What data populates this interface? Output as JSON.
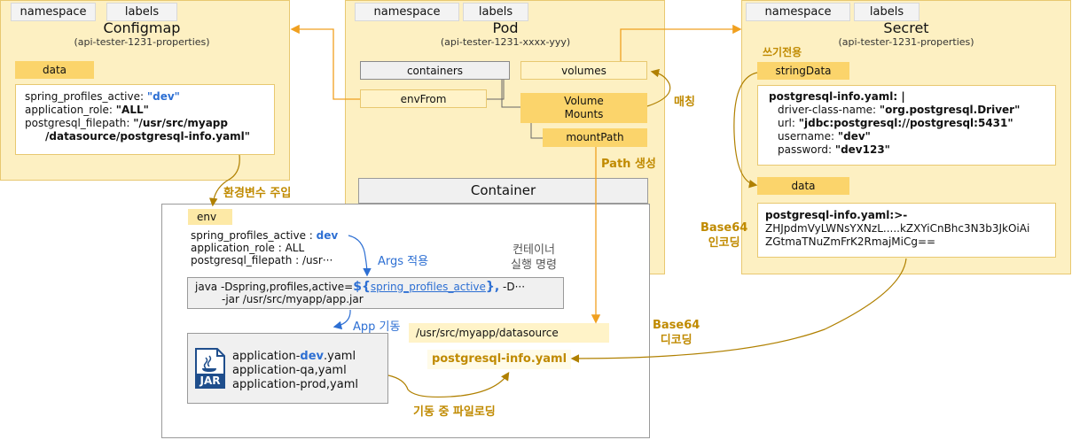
{
  "configmap": {
    "tab_namespace": "namespace",
    "tab_labels": "labels",
    "title": "Configmap",
    "subtitle": "(api-tester-1231-properties)",
    "data_chip": "data",
    "line1_key": "spring_profiles_active: ",
    "line1_val": "\"dev\"",
    "line2_key": "application_role: ",
    "line2_val": "\"ALL\"",
    "line3_key": "postgresql_filepath: ",
    "line3_val": "\"/usr/src/myapp",
    "line4_val": "/datasource/postgresql-info.yaml\""
  },
  "pod": {
    "tab_namespace": "namespace",
    "tab_labels": "labels",
    "title": "Pod",
    "subtitle": "(api-tester-1231-xxxx-yyy)",
    "containers": "containers",
    "volumes": "volumes",
    "envfrom": "envFrom",
    "volume_mounts_1": "Volume",
    "volume_mounts_2": "Mounts",
    "mountpath": "mountPath"
  },
  "secret": {
    "tab_namespace": "namespace",
    "tab_labels": "labels",
    "title": "Secret",
    "subtitle": "(api-tester-1231-properties)",
    "write_only": "쓰기전용",
    "stringdata_chip": "stringData",
    "sd_head": "postgresql-info.yaml: |",
    "sd_l1_key": "driver-class-name: ",
    "sd_l1_val": "\"org.postgresql.Driver\"",
    "sd_l2_key": "url: ",
    "sd_l2_val": "\"jdbc:postgresql://postgresql:5431\"",
    "sd_l3_key": "username: ",
    "sd_l3_val": "\"dev\"",
    "sd_l4_key": "password: ",
    "sd_l4_val": "\"dev123\"",
    "data_chip": "data",
    "d_head": "postgresql-info.yaml:>-",
    "d_l1": "ZHJpdmVyLWNsYXNzL.....kZXYiCnBhc3N3b3JkOiAi",
    "d_l2": "ZGtmaTNuZmFrK2RmajMiCg=="
  },
  "container": {
    "title": "Container",
    "env_chip": "env",
    "env_l1_key": "spring_profiles_active : ",
    "env_l1_val": "dev",
    "env_l2": "application_role : ALL",
    "env_l3": "postgresql_filepath : /usr···",
    "cmd_l1_a": "java -Dspring,profiles,active=",
    "cmd_l1_b": "${",
    "cmd_l1_c": "spring_profiles_active",
    "cmd_l1_d": "},",
    "cmd_l1_e": " -D···",
    "cmd_l2": "-jar /usr/src/myapp/app.jar",
    "run_cmd_1": "컨테이너",
    "run_cmd_2": "실행 명령",
    "jar_label": "JAR",
    "jar_l1_a": "application-",
    "jar_l1_b": "dev",
    "jar_l1_c": ".yaml",
    "jar_l2": "application-qa,yaml",
    "jar_l3": "application-prod,yaml",
    "ds_path": "/usr/src/myapp/datasource",
    "ds_file": "postgresql-info.yaml"
  },
  "annotations": {
    "env_inject": "환경변수 주입",
    "match": "매칭",
    "path_create": "Path 생성",
    "args_apply": "Args 적용",
    "app_start": "App 기동",
    "base64_enc_1": "Base64",
    "base64_enc_2": "인코딩",
    "base64_dec_1": "Base64",
    "base64_dec_2": "디코딩",
    "file_load": "기동 중 파일로딩"
  },
  "colors": {
    "panel": "#fdf0c2",
    "chip": "#fbd46b",
    "accent_gold": "#c08a00",
    "arrow_orange": "#f0a020",
    "blue": "#2d6fd3"
  }
}
